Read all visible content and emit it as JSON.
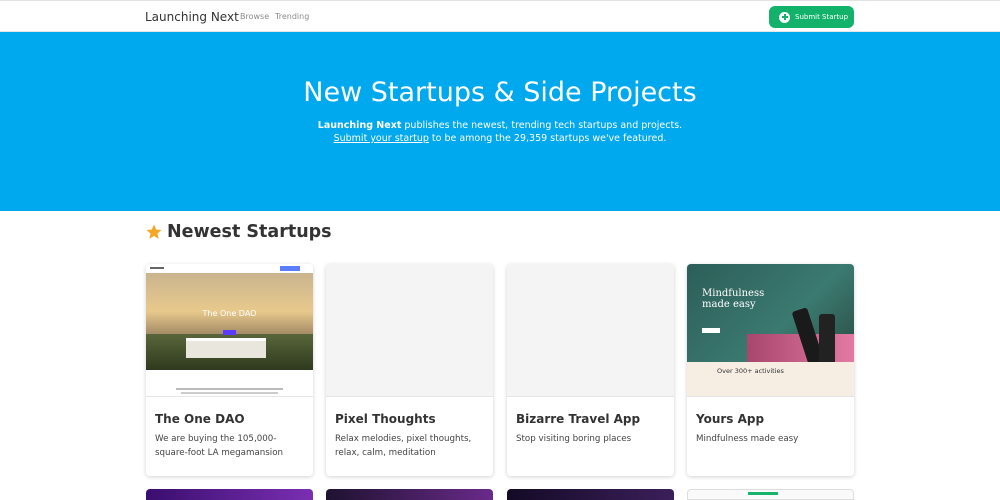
{
  "navbar": {
    "brand": "Launching Next",
    "links": [
      "Browse",
      "Trending"
    ],
    "submit_label": "Submit Startup"
  },
  "hero": {
    "title": "New Startups & Side Projects",
    "line1_bold": "Launching Next",
    "line1_rest": " publishes the newest, trending tech startups and projects.",
    "line2_link": "Submit your startup",
    "line2_rest": " to be among the 29,359 startups we've featured."
  },
  "section": {
    "title": "Newest Startups",
    "icon": "star-icon"
  },
  "cards": [
    {
      "title": "The One DAO",
      "description": "We are buying the 105,000-square-foot LA megamansion",
      "image_text": "The One DAO"
    },
    {
      "title": "Pixel Thoughts",
      "description": "Relax melodies, pixel thoughts, relax, calm, meditation"
    },
    {
      "title": "Bizarre Travel App",
      "description": "Stop visiting boring places"
    },
    {
      "title": "Yours App",
      "description": "Mindfulness made easy",
      "image_heading_1": "Mindfulness",
      "image_heading_2": "made easy",
      "image_count": "Over 300+ activities"
    }
  ],
  "colors": {
    "hero_bg": "#00a8ee",
    "submit_bg": "#13b26b",
    "star": "#f5a623"
  }
}
